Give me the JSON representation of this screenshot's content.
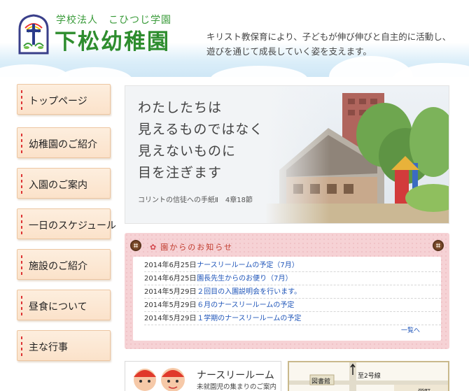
{
  "header": {
    "school_kind": "学校法人　こひつじ学園",
    "school_name": "下松幼稚園",
    "tagline_line1": "キリスト教保育により、子どもが伸び伸びと自主的に活動し、",
    "tagline_line2": "遊びを通じて成長していく姿を支えます。"
  },
  "nav": {
    "items": [
      {
        "label": "トップページ"
      },
      {
        "label": "幼稚園のご紹介"
      },
      {
        "label": "入園のご案内"
      },
      {
        "label": "一日のスケジュール"
      },
      {
        "label": "施設のご紹介"
      },
      {
        "label": "昼食について"
      },
      {
        "label": "主な行事"
      }
    ]
  },
  "hero": {
    "lines": [
      "わたしたちは",
      "見えるものではなく",
      "見えないものに",
      "目を注ぎます"
    ],
    "citation": "コリントの信徒への手紙Ⅱ　4章18節"
  },
  "news": {
    "title": "園からのお知らせ",
    "items": [
      {
        "date": "2014年6月25日",
        "text": "ナースリールームの予定（7月）"
      },
      {
        "date": "2014年6月25日",
        "text": "園長先生からのお便り（7月）"
      },
      {
        "date": "2014年5月29日",
        "text": "２回目の入園説明会を行います。"
      },
      {
        "date": "2014年5月29日",
        "text": "６月のナースリールームの予定"
      },
      {
        "date": "2014年5月29日",
        "text": "１学期のナースリールームの予定"
      }
    ],
    "more": "一覧へ"
  },
  "nursery": {
    "title": "ナースリールーム",
    "subtitle": "未就園児の集まりのご案内"
  },
  "map": {
    "to_route": "至2号線",
    "library": "図書館",
    "sakae": "栄町"
  },
  "colors": {
    "accent_green": "#2e8d2e",
    "news_red": "#c0392b",
    "link_blue": "#1f55b9",
    "nav_bg": "#fbe2ca"
  }
}
